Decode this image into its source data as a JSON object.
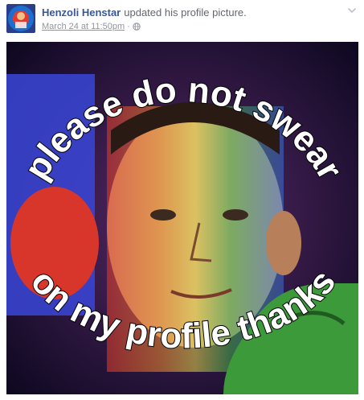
{
  "post": {
    "author_name": "Henzoli Henstar",
    "action_text": "updated his profile picture.",
    "timestamp": "March 24 at 11:50pm",
    "separator": "·",
    "privacy_icon": "globe-icon",
    "menu_icon": "chevron-down-icon"
  },
  "photo": {
    "caption_top": "please do not swear",
    "caption_bottom": "on my profile thanks"
  },
  "colors": {
    "author_link": "#365899",
    "meta_text": "#90949c"
  }
}
